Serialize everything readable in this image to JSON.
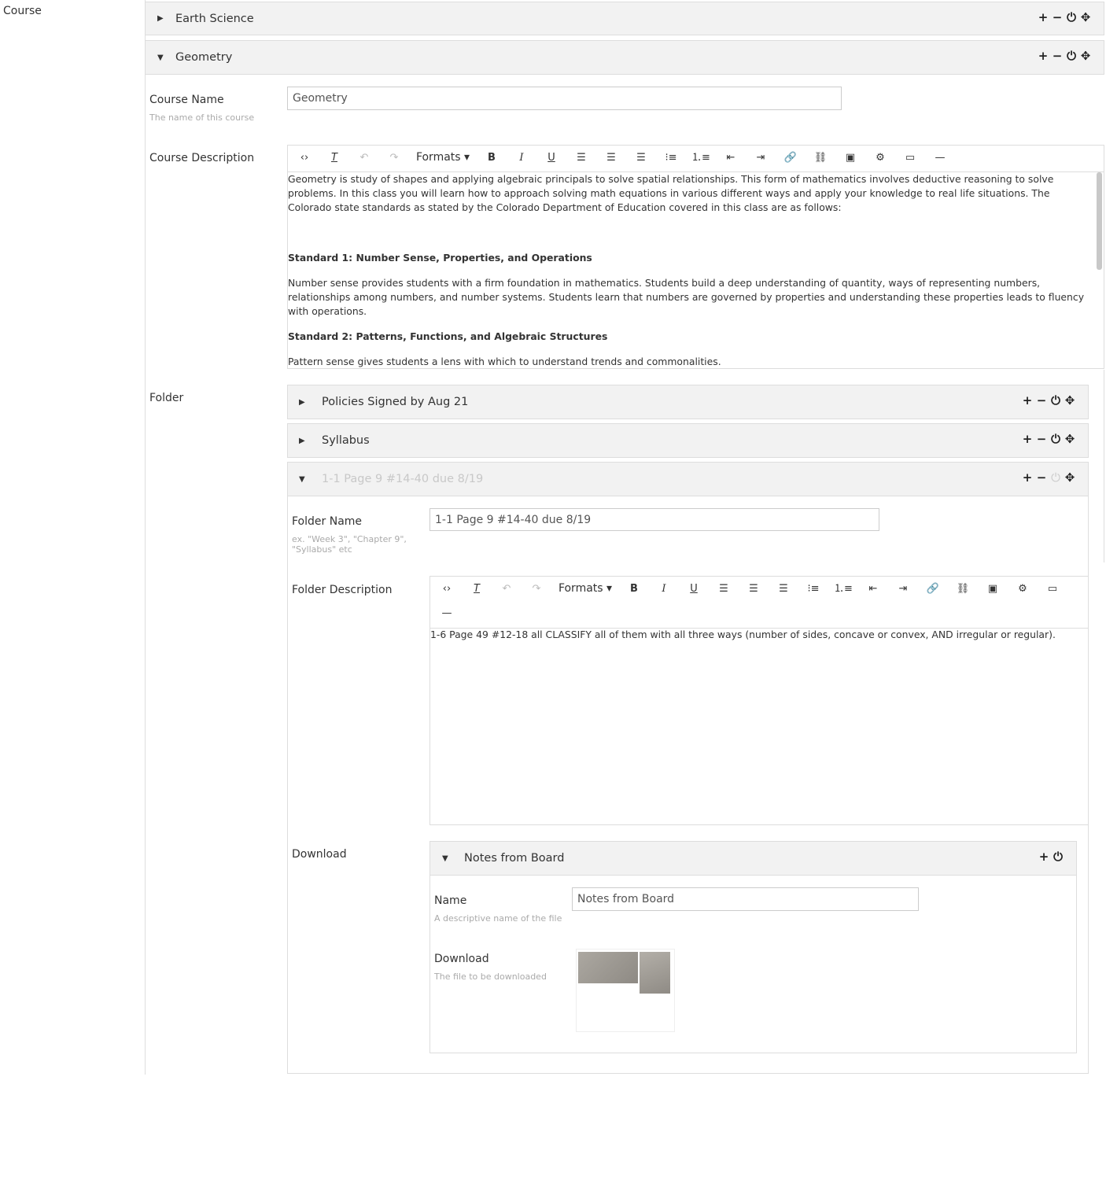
{
  "course_label": "Course",
  "panels": {
    "earth_science": {
      "title": "Earth Science"
    },
    "geometry": {
      "title": "Geometry"
    }
  },
  "course_name": {
    "label": "Course Name",
    "help": "The name of this course",
    "value": "Geometry"
  },
  "course_description": {
    "label": "Course Description",
    "toolbar": {
      "formats": "Formats"
    },
    "intro": "Geometry is study of shapes and applying algebraic principals to solve spatial relationships. This form of mathematics involves deductive reasoning to solve problems. In this class you will learn how to approach solving math equations in various different ways and apply your knowledge to real life situations. The Colorado state standards as stated by the Colorado Department of Education covered in this class are as follows:",
    "std1_heading": "Standard 1: Number Sense, Properties, and Operations",
    "std1_text": "Number sense provides students with a firm foundation in mathematics. Students build a deep understanding of quantity, ways of representing numbers, relationships among numbers, and number systems. Students learn that numbers are governed by properties and understanding these properties leads to fluency with operations.",
    "std2_heading": "Standard 2: Patterns, Functions, and Algebraic Structures",
    "std2_text": "Pattern sense gives students a lens with which to understand trends and commonalities."
  },
  "folder": {
    "label": "Folder",
    "items": [
      {
        "title": "Policies Signed by Aug 21"
      },
      {
        "title": "Syllabus"
      },
      {
        "title": "1-1 Page 9 #14-40 due 8/19"
      }
    ],
    "name": {
      "label": "Folder Name",
      "help": "ex. \"Week 3\", \"Chapter 9\", \"Syllabus\" etc",
      "value": "1-1 Page 9 #14-40 due 8/19"
    },
    "description": {
      "label": "Folder Description",
      "formats": "Formats",
      "text": "1-6 Page 49 #12-18 all CLASSIFY all of them with all three ways (number of sides, concave or convex, AND irregular or regular)."
    }
  },
  "download": {
    "label": "Download",
    "panel_title": "Notes from Board",
    "name": {
      "label": "Name",
      "help": "A descriptive name of the file",
      "value": "Notes from Board"
    },
    "file": {
      "label": "Download",
      "help": "The file to be downloaded"
    }
  },
  "icons": {
    "add": "+",
    "remove": "−",
    "power": "⏻",
    "move": "✥"
  }
}
